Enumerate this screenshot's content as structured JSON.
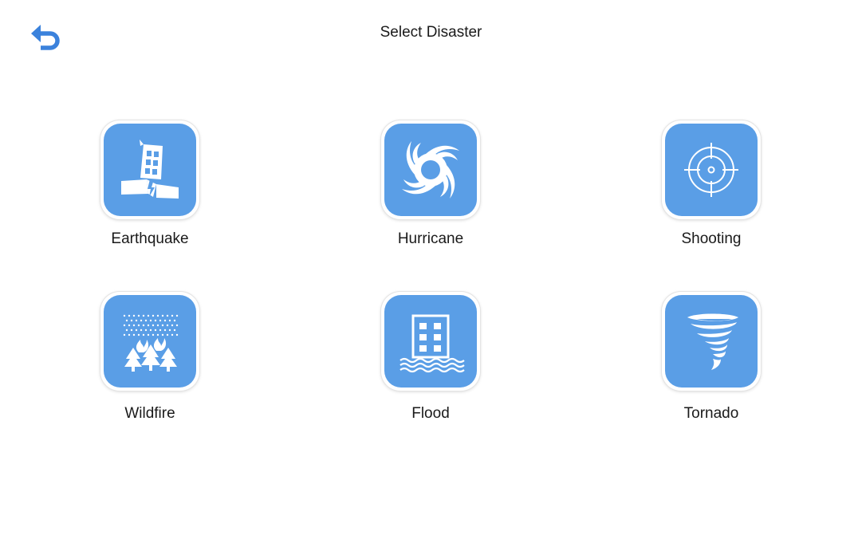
{
  "header": {
    "title": "Select Disaster",
    "back_icon": "undo-arrow-icon"
  },
  "colors": {
    "accent": "#3b82dc",
    "tile_fill": "#5a9ee6",
    "icon_fg": "#ffffff",
    "background": "#ffffff"
  },
  "disasters": [
    {
      "label": "Earthquake",
      "icon": "earthquake-building-icon"
    },
    {
      "label": "Hurricane",
      "icon": "hurricane-icon"
    },
    {
      "label": "Shooting",
      "icon": "crosshair-icon"
    },
    {
      "label": "Wildfire",
      "icon": "wildfire-trees-icon"
    },
    {
      "label": "Flood",
      "icon": "flood-building-icon"
    },
    {
      "label": "Tornado",
      "icon": "tornado-icon"
    }
  ]
}
